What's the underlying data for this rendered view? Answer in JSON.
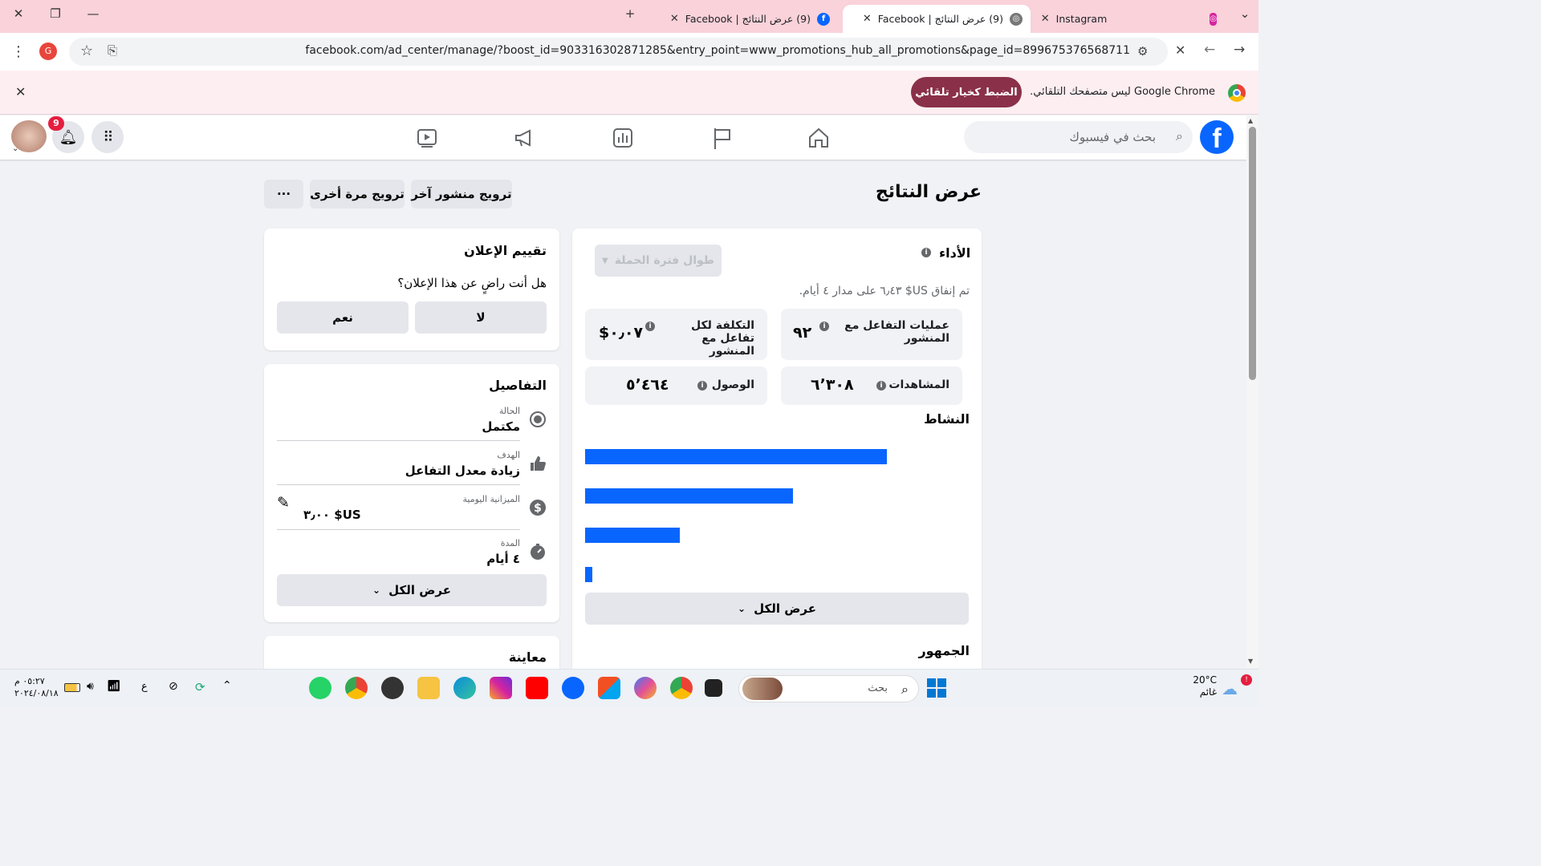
{
  "browser": {
    "tabs": [
      {
        "title": "Instagram"
      },
      {
        "title": "(9) عرض النتائج | Facebook"
      },
      {
        "title": "(9) عرض النتائج | Facebook"
      }
    ],
    "url": "facebook.com/ad_center/manage/?boost_id=903316302871285&entry_point=www_promotions_hub_all_promotions&page_id=899675376568711",
    "profile_initial": "G"
  },
  "infobar": {
    "message": "Google Chrome ليس متصفحك التلقائي.",
    "button": "الضبط كخيار تلقائي"
  },
  "header": {
    "search_placeholder": "بحث في فيسبوك",
    "notification_count": "9"
  },
  "page": {
    "title": "عرض النتائج",
    "buttons": {
      "promote_another": "ترويج منشور آخر",
      "promote_again": "ترويج مرة أخرى",
      "more": "···"
    }
  },
  "performance": {
    "title": "الأداء",
    "period_select": "طوال فترة الحملة",
    "spend_text": "تم إنفاق US$ ٦٫٤٣ على مدار ٤ أيام.",
    "stats": [
      {
        "label": "عمليات التفاعل مع المنشور",
        "value": "٩٢"
      },
      {
        "label": "التكلفة لكل تفاعل مع المنشور",
        "value": "$٠٫٠٧"
      },
      {
        "label": "المشاهدات",
        "value": "٦٬٣٠٨"
      },
      {
        "label": "الوصول",
        "value": "٥٬٤٦٤"
      }
    ],
    "activity_title": "النشاط",
    "activity_bars": [
      0.8,
      0.55,
      0.25,
      0.02
    ],
    "see_all": "عرض الكل",
    "audience_title": "الجمهور"
  },
  "rating": {
    "title": "تقييم الإعلان",
    "question": "هل أنت راضٍ عن هذا الإعلان؟",
    "yes": "نعم",
    "no": "لا"
  },
  "details": {
    "title": "التفاصيل",
    "items": [
      {
        "label": "الحالة",
        "value": "مكتمل"
      },
      {
        "label": "الهدف",
        "value": "زيادة معدل التفاعل"
      },
      {
        "label": "الميزانية اليومية",
        "value": "US$ ٣٫٠٠"
      },
      {
        "label": "المدة",
        "value": "٤ أيام"
      }
    ],
    "see_all": "عرض الكل"
  },
  "preview": {
    "title": "معاينة"
  },
  "taskbar": {
    "weather_temp": "20°C",
    "weather_desc": "غائم",
    "search": "بحث",
    "time": "٠٥:٢٧ م",
    "date": "٢٠٢٤/٠٨/١٨",
    "lang": "ع"
  },
  "colors": {
    "fb_blue": "#0866ff",
    "tabbar": "#f9d2da",
    "set_default": "#8a3049"
  }
}
